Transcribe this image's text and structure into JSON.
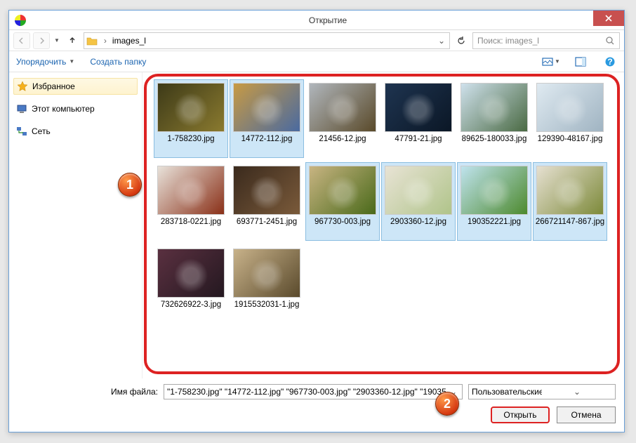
{
  "window": {
    "title": "Открытие"
  },
  "nav": {
    "location": "images_l",
    "search_placeholder": "Поиск: images_l"
  },
  "toolbar": {
    "organize": "Упорядочить",
    "new_folder": "Создать папку"
  },
  "sidebar": {
    "items": [
      {
        "label": "Избранное"
      },
      {
        "label": "Этот компьютер"
      },
      {
        "label": "Сеть"
      }
    ]
  },
  "files": [
    {
      "name": "1-758230.jpg",
      "selected": true,
      "c1": "#3d3a18",
      "c2": "#8a7a2f"
    },
    {
      "name": "14772-112.jpg",
      "selected": true,
      "c1": "#c79a44",
      "c2": "#4a6aa0"
    },
    {
      "name": "21456-12.jpg",
      "selected": false,
      "c1": "#b0b6bc",
      "c2": "#5a4a2a"
    },
    {
      "name": "47791-21.jpg",
      "selected": false,
      "c1": "#1e3450",
      "c2": "#0b1726"
    },
    {
      "name": "89625-180033.jpg",
      "selected": false,
      "c1": "#cfe1ec",
      "c2": "#4a6a43"
    },
    {
      "name": "129390-48167.jpg",
      "selected": false,
      "c1": "#dfeaf1",
      "c2": "#a0b4c2"
    },
    {
      "name": "283718-0221.jpg",
      "selected": false,
      "c1": "#e8e2da",
      "c2": "#8a3018"
    },
    {
      "name": "693771-2451.jpg",
      "selected": false,
      "c1": "#3a2a1d",
      "c2": "#7a5a3a"
    },
    {
      "name": "967730-003.jpg",
      "selected": true,
      "c1": "#c8b482",
      "c2": "#4a6a1a"
    },
    {
      "name": "2903360-12.jpg",
      "selected": true,
      "c1": "#e8e3d5",
      "c2": "#b0c48a"
    },
    {
      "name": "190352221.jpg",
      "selected": true,
      "c1": "#bfe3ee",
      "c2": "#4d8a2e"
    },
    {
      "name": "266721147-867.jpg",
      "selected": true,
      "c1": "#e6e0d1",
      "c2": "#7d8a3a"
    },
    {
      "name": "732626922-3.jpg",
      "selected": false,
      "c1": "#5a3040",
      "c2": "#241820"
    },
    {
      "name": "1915532031-1.jpg",
      "selected": false,
      "c1": "#c8b28a",
      "c2": "#5a4a2c"
    }
  ],
  "footer": {
    "filename_label": "Имя файла:",
    "filename_value": "\"1-758230.jpg\" \"14772-112.jpg\" \"967730-003.jpg\" \"2903360-12.jpg\" \"19035",
    "filter": "Пользовательские файлы (*.b",
    "open": "Открыть",
    "cancel": "Отмена"
  },
  "markers": {
    "m1": "1",
    "m2": "2"
  }
}
